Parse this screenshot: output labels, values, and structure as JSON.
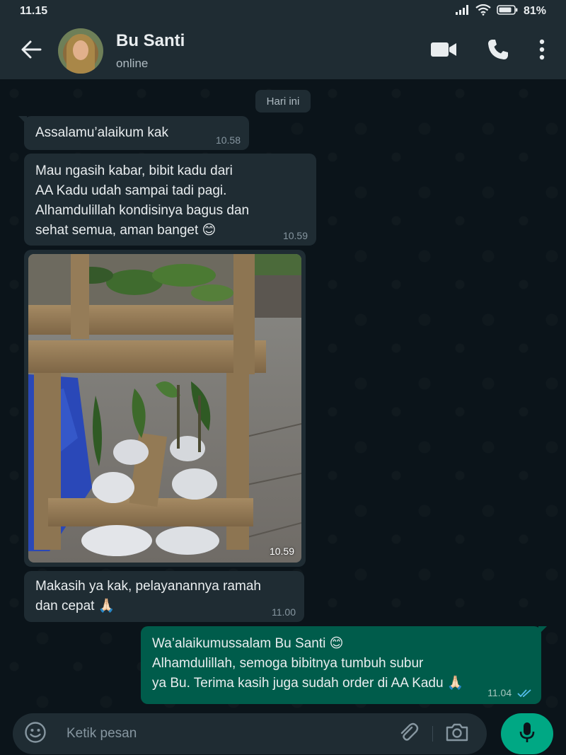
{
  "status_bar": {
    "time": "11.15",
    "battery": "81%"
  },
  "header": {
    "contact_name": "Bu Santi",
    "contact_status": "online",
    "icons": [
      "back-arrow-icon",
      "video-call-icon",
      "phone-icon",
      "more-vert-icon"
    ]
  },
  "chat": {
    "date_chip": "Hari ini",
    "messages": [
      {
        "direction": "in",
        "text": "Assalamu’alaikum kak",
        "time": "10.58"
      },
      {
        "direction": "in",
        "lines": [
          "Mau ngasih kabar, bibit kadu dari",
          "AA Kadu udah sampai tadi pagi.",
          "Alhamdulillah kondisinya bagus dan",
          "sehat semua, aman banget 😊"
        ],
        "time": "10.59"
      },
      {
        "direction": "in",
        "type": "photo",
        "time": "10.59"
      },
      {
        "direction": "in",
        "lines": [
          "Makasih ya kak, pelayanannya ramah",
          "dan cepat 🙏🏻"
        ],
        "time": "11.00"
      },
      {
        "direction": "out",
        "lines": [
          "Wa’alaikumussalam Bu Santi 😊",
          "Alhamdulillah, semoga bibitnya tumbuh subur",
          "ya Bu. Terima kasih juga sudah order di AA Kadu 🙏🏻"
        ],
        "time": "11.04",
        "status": "read"
      }
    ]
  },
  "composer": {
    "placeholder": "Ketik pesan",
    "icons": [
      "emoji-icon",
      "attach-icon",
      "camera-icon",
      "mic-icon"
    ]
  },
  "colors": {
    "background": "#0b141a",
    "header": "#1f2c33",
    "incoming_bubble": "#1f2c33",
    "outgoing_bubble": "#005c4b",
    "accent": "#00a884",
    "read_ticks": "#53bdeb"
  }
}
